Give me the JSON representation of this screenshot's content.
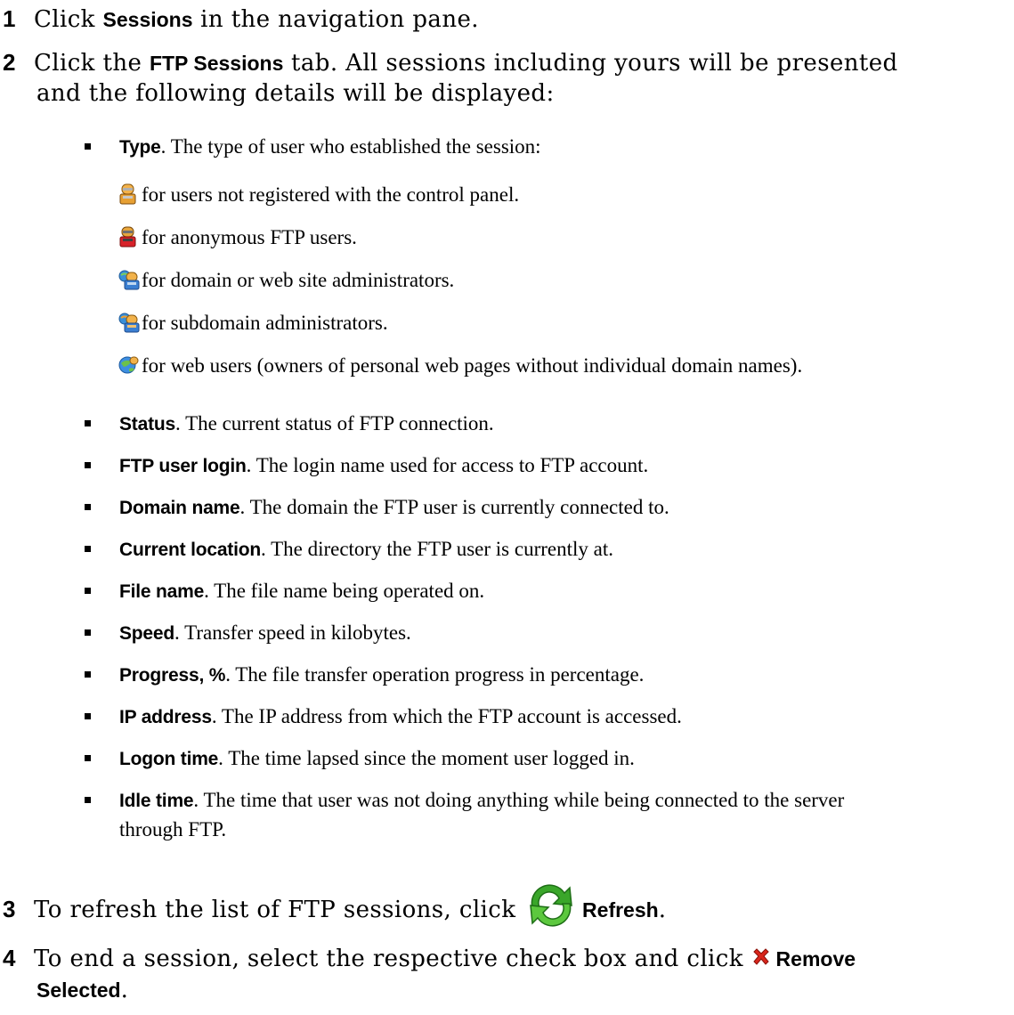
{
  "steps": [
    {
      "num": "1",
      "pre": "Click ",
      "ui": "Sessions",
      "post": " in the navigation pane."
    },
    {
      "num": "2",
      "pre": "Click the ",
      "ui": "FTP Sessions",
      "post": " tab. All sessions including yours will be presented",
      "line2": "and the following details will be displayed:"
    },
    {
      "num": "3",
      "pre": "To refresh the list of FTP sessions, click ",
      "ui": "Refresh",
      "post": "."
    },
    {
      "num": "4",
      "pre": "To end a session, select the respective check box and click ",
      "ui": "Remove",
      "ui2": "Selected",
      "post": "."
    }
  ],
  "type_item": {
    "term": "Type",
    "desc": ". The type of user who established the session:"
  },
  "user_types": [
    {
      "icon": "user-not-registered-icon",
      "text": "for users not registered with the control panel."
    },
    {
      "icon": "anonymous-ftp-user-icon",
      "text": "for anonymous FTP users."
    },
    {
      "icon": "domain-admin-icon",
      "text": "for domain or web site administrators."
    },
    {
      "icon": "subdomain-admin-icon",
      "text": "for subdomain administrators."
    },
    {
      "icon": "web-user-icon",
      "text": "for web users (owners of personal web pages without individual domain names)."
    }
  ],
  "fields": [
    {
      "term": "Status",
      "desc": ". The current status of FTP connection."
    },
    {
      "term": "FTP user login",
      "desc": ". The login name used for access to FTP account."
    },
    {
      "term": "Domain name",
      "desc": ". The domain the FTP user is currently connected to."
    },
    {
      "term": "Current location",
      "desc": ". The directory the FTP user is currently at."
    },
    {
      "term": "File name",
      "desc": ". The file name being operated on."
    },
    {
      "term": "Speed",
      "desc": ". Transfer speed in kilobytes."
    },
    {
      "term": "Progress, %",
      "desc": ". The file transfer operation progress in percentage."
    },
    {
      "term": "IP address",
      "desc": ". The IP address from which the FTP account is accessed."
    },
    {
      "term": "Logon time",
      "desc": ". The time lapsed since the moment user logged in."
    },
    {
      "term": "Idle time",
      "desc": ". The time that user was not doing anything while being connected to the server",
      "line2": "through FTP."
    }
  ],
  "colors": {
    "refresh_green": "#3aa62a",
    "remove_red": "#d9261c"
  }
}
